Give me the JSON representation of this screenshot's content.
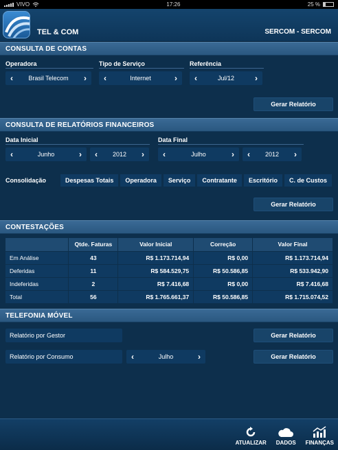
{
  "status": {
    "carrier": "VIVO",
    "time": "17:26",
    "battery": "25 %"
  },
  "header": {
    "app_name": "TEL & COM",
    "company": "SERCOM - SERCOM"
  },
  "consulta_contas": {
    "title": "CONSULTA DE CONTAS",
    "operadora": {
      "label": "Operadora",
      "value": "Brasil Telecom"
    },
    "tipo_servico": {
      "label": "Tipo de Serviço",
      "value": "Internet"
    },
    "referencia": {
      "label": "Referência",
      "value": "Jul/12"
    },
    "button": "Gerar Relatório"
  },
  "consulta_relatorios": {
    "title": "CONSULTA DE RELATÓRIOS FINANCEIROS",
    "data_inicial": {
      "label": "Data Inicial",
      "month": "Junho",
      "year": "2012"
    },
    "data_final": {
      "label": "Data Final",
      "month": "Julho",
      "year": "2012"
    },
    "consolidacao_label": "Consolidação",
    "tabs": [
      "Despesas Totais",
      "Operadora",
      "Serviço",
      "Contratante",
      "Escritório",
      "C. de Custos"
    ],
    "button": "Gerar Relatório"
  },
  "contestacoes": {
    "title": "CONTESTAÇÕES",
    "columns": [
      "",
      "Qtde. Faturas",
      "Valor Inicial",
      "Correção",
      "Valor Final"
    ],
    "rows": [
      [
        "Em Análise",
        "43",
        "R$ 1.173.714,94",
        "R$ 0,00",
        "R$ 1.173.714,94"
      ],
      [
        "Deferidas",
        "11",
        "R$ 584.529,75",
        "R$ 50.586,85",
        "R$ 533.942,90"
      ],
      [
        "Indeferidas",
        "2",
        "R$ 7.416,68",
        "R$ 0,00",
        "R$ 7.416,68"
      ],
      [
        "Total",
        "56",
        "R$ 1.765.661,37",
        "R$ 50.586,85",
        "R$ 1.715.074,52"
      ]
    ]
  },
  "telefonia": {
    "title": "TELEFONIA MÓVEL",
    "gestor_label": "Relatório por Gestor",
    "consumo_label": "Relatório por Consumo",
    "consumo_month": "Julho",
    "button": "Gerar Relatório"
  },
  "toolbar": {
    "atualizar": "ATUALIZAR",
    "dados": "DADOS",
    "financas": "FINANÇAS"
  }
}
